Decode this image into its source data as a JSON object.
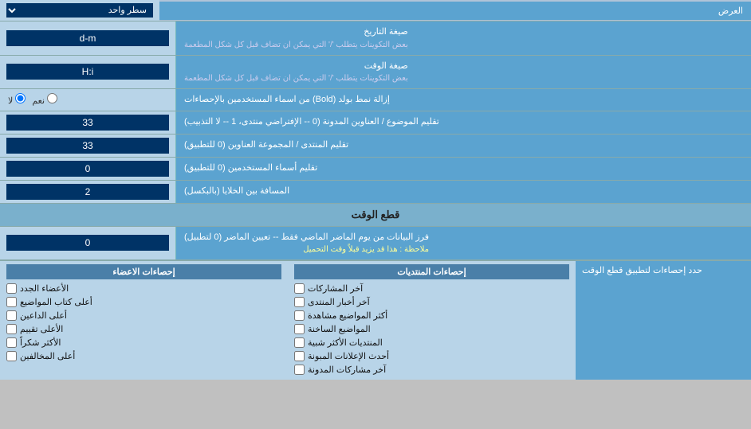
{
  "page": {
    "title": "العرض",
    "display_mode_label": "العرض",
    "display_mode_value": "سطر واحد",
    "date_format_label": "صيغة التاريخ",
    "date_format_sublabel": "بعض التكوينات يتطلب '/' التي يمكن ان تضاف قبل كل شكل المطعمة",
    "date_format_value": "d-m",
    "time_format_label": "صيغة الوقت",
    "time_format_sublabel": "بعض التكوينات يتطلب '/' التي يمكن ان تضاف قبل كل شكل المطعمة",
    "time_format_value": "H:i",
    "bold_label": "إزالة نمط بولد (Bold) من اسماء المستخدمين بالإحصاءات",
    "bold_yes": "نعم",
    "bold_no": "لا",
    "titles_label": "تقليم الموضوع / العناوين المدونة (0 -- الإفتراضي منتدى، 1 -- لا التذبيب)",
    "titles_value": "33",
    "forum_titles_label": "تقليم المنتدى / المجموعة العناوين (0 للتطبيق)",
    "forum_titles_value": "33",
    "usernames_label": "تقليم أسماء المستخدمين (0 للتطبيق)",
    "usernames_value": "0",
    "spacing_label": "المسافة بين الخلايا (بالبكسل)",
    "spacing_value": "2",
    "time_section": "قطع الوقت",
    "time_cut_label": "فرز البيانات من يوم الماضر الماضي فقط -- تعيين الماضر (0 لتطبيل)",
    "time_cut_note": "ملاحظة : هذا قد يزيد قبلاً وقت التحميل",
    "time_cut_value": "0",
    "stats_apply_label": "حدد إحصاءات لتطبيق قطع الوقت",
    "col1_header": "إحصاءات المنتديات",
    "col2_header": "إحصاءات الاعضاء",
    "col1_items": [
      "آخر المشاركات",
      "آخر أخبار المنتدى",
      "أكثر المواضيع مشاهدة",
      "المواضيع الساخنة",
      "المنتديات الأكثر شبية",
      "أحدث الإعلانات المبونة",
      "آخر مشاركات المدونة"
    ],
    "col2_items": [
      "الأعضاء الجدد",
      "أعلى كتاب المواضيع",
      "أعلى الداعين",
      "الأعلى تقييم",
      "الأكثر شكراً",
      "أعلى المخالفين"
    ]
  }
}
